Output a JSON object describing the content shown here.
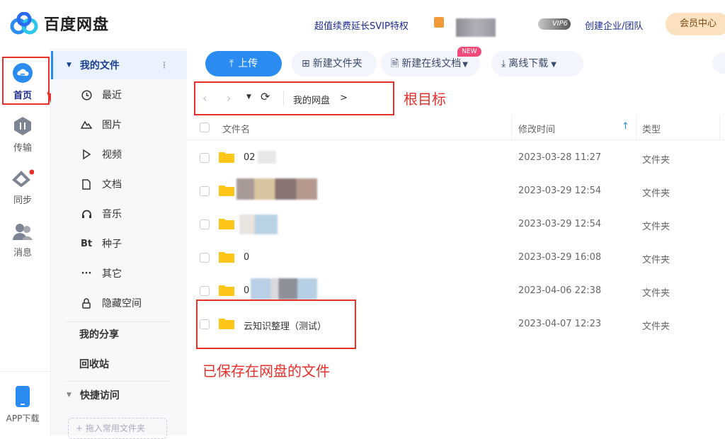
{
  "header": {
    "app_title": "百度网盘",
    "svip_promo": "超值续费延长SVIP特权",
    "vip_badge": "VIP6",
    "enterprise_link": "创建企业/团队",
    "member_center": "会员中心"
  },
  "rail": {
    "items": [
      {
        "label": "首页",
        "icon": "cloud-home-icon"
      },
      {
        "label": "传输",
        "icon": "transfer-icon"
      },
      {
        "label": "同步",
        "icon": "sync-icon"
      },
      {
        "label": "消息",
        "icon": "message-icon"
      }
    ],
    "app_download": "APP下载"
  },
  "sidebar": {
    "my_files": "我的文件",
    "items": [
      {
        "label": "最近",
        "icon": "clock-icon"
      },
      {
        "label": "图片",
        "icon": "mountain-icon"
      },
      {
        "label": "视频",
        "icon": "play-icon"
      },
      {
        "label": "文档",
        "icon": "document-icon"
      },
      {
        "label": "音乐",
        "icon": "headphones-icon"
      },
      {
        "label": "种子",
        "icon": "bt-icon",
        "glyph": "Bt"
      },
      {
        "label": "其它",
        "icon": "more-icon",
        "glyph": "···"
      },
      {
        "label": "隐藏空间",
        "icon": "lock-icon"
      }
    ],
    "my_share": "我的分享",
    "recycle": "回收站",
    "quick_access": "快捷访问",
    "drag_hint": "+ 拖入常用文件夹"
  },
  "toolbar": {
    "upload": "上传",
    "new_folder": "新建文件夹",
    "new_online_doc": "新建在线文档",
    "new_tag": "NEW",
    "offline_download": "离线下载"
  },
  "breadcrumb": {
    "root": "我的网盘",
    "separator": ">"
  },
  "annotations": {
    "root_dir": "根目标",
    "saved_files": "已保存在网盘的文件"
  },
  "table": {
    "columns": {
      "name": "文件名",
      "modified": "修改时间",
      "type": "类型"
    },
    "rows": [
      {
        "name": "02",
        "modified": "2023-03-28 11:27",
        "type": "文件夹"
      },
      {
        "name": "",
        "modified": "2023-03-29 12:54",
        "type": "文件夹"
      },
      {
        "name": "",
        "modified": "2023-03-29 12:54",
        "type": "文件夹"
      },
      {
        "name": "0",
        "modified": "2023-03-29 16:08",
        "type": "文件夹"
      },
      {
        "name": "0",
        "modified": "2023-04-06 22:38",
        "type": "文件夹"
      },
      {
        "name": "云知识整理（测试）",
        "modified": "2023-04-07 12:23",
        "type": "文件夹"
      }
    ]
  },
  "colors": {
    "accent": "#2a8cf0",
    "annotation_red": "#e8302b",
    "folder_yellow": "#ffc61a"
  }
}
